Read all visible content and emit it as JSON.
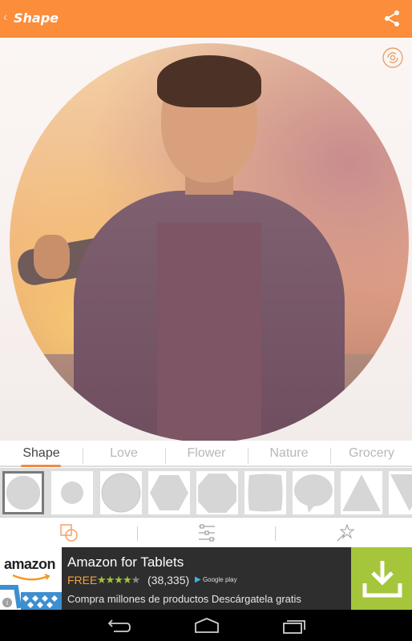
{
  "app": {
    "title": "Shape",
    "back_glyph": "‹",
    "accent_color": "#fb8d3b"
  },
  "topbar": {
    "share_icon": "share-icon"
  },
  "canvas": {
    "photo_description": "Man in hoodie at sunset, cropped to circle",
    "swap_icon": "swap-icon"
  },
  "tabs": [
    {
      "label": "Shape",
      "active": true
    },
    {
      "label": "Love",
      "active": false
    },
    {
      "label": "Flower",
      "active": false
    },
    {
      "label": "Nature",
      "active": false
    },
    {
      "label": "Grocery",
      "active": false
    }
  ],
  "shapes": [
    {
      "name": "circle-large",
      "selected": true
    },
    {
      "name": "circle-small",
      "selected": false
    },
    {
      "name": "circle-outline",
      "selected": false
    },
    {
      "name": "hexagon",
      "selected": false
    },
    {
      "name": "octagon",
      "selected": false
    },
    {
      "name": "rounded-square",
      "selected": false
    },
    {
      "name": "speech-bubble",
      "selected": false
    },
    {
      "name": "triangle",
      "selected": false
    },
    {
      "name": "inverted-triangle",
      "selected": false
    }
  ],
  "toolbar": {
    "items": [
      {
        "name": "shape-tool",
        "icon": "shapes-icon",
        "active": true
      },
      {
        "name": "adjust-tool",
        "icon": "sliders-icon",
        "active": false
      },
      {
        "name": "effects-tool",
        "icon": "magic-wand-icon",
        "active": false
      }
    ]
  },
  "ad": {
    "brand": "amazon",
    "title": "Amazon for Tablets",
    "price": "FREE",
    "rating": 4,
    "rating_max": 5,
    "stars_on": "★★★★",
    "stars_off": "★",
    "reviews": "(38,335)",
    "store": "Google play",
    "description": "Compra millones de productos Descárgatela gratis",
    "info_glyph": "i",
    "download_color": "#a5c63b"
  },
  "navbar": {
    "items": [
      "back",
      "home",
      "recents"
    ]
  }
}
